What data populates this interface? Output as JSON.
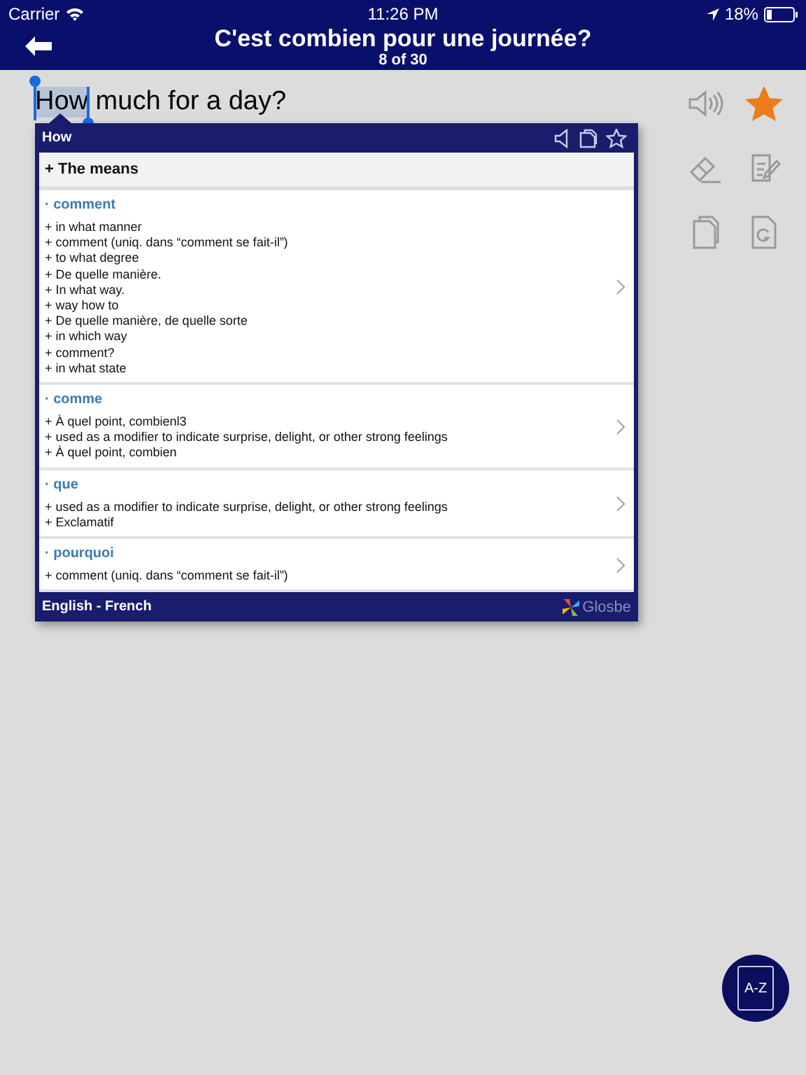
{
  "status_bar": {
    "carrier": "Carrier",
    "time": "11:26 PM",
    "battery": "18%"
  },
  "nav": {
    "title": "C'est combien pour une journée?",
    "subtitle": "8 of 30"
  },
  "sentence": {
    "selected_word": "How",
    "rest": " much for a day?"
  },
  "side_tools": {
    "starred": true
  },
  "popup": {
    "word": "How",
    "heading": "+ The means",
    "entries": [
      {
        "term": "· comment",
        "senses": [
          "+ in what manner",
          "+ comment (uniq. dans “comment se fait-il”)",
          "+ to what degree",
          "+ De quelle manière.",
          "+ In what way.",
          "+ way how to",
          "+ De quelle manière, de quelle sorte",
          "+ in which way",
          "+ comment?",
          "+ in what state"
        ]
      },
      {
        "term": "· comme",
        "senses": [
          "+ À quel point, combienl3",
          "+ used as a modifier to indicate surprise, delight, or other strong feelings",
          "+ À quel point, combien"
        ]
      },
      {
        "term": "· que",
        "senses": [
          "+ used as a modifier to indicate surprise, delight, or other strong feelings",
          "+ Exclamatif"
        ]
      },
      {
        "term": "· pourquoi",
        "senses": [
          "+ comment (uniq. dans “comment se fait-il”)"
        ]
      }
    ],
    "language_pair": "English - French",
    "provider": "Glosbe"
  },
  "dictionary_button": {
    "label": "A-Z"
  }
}
